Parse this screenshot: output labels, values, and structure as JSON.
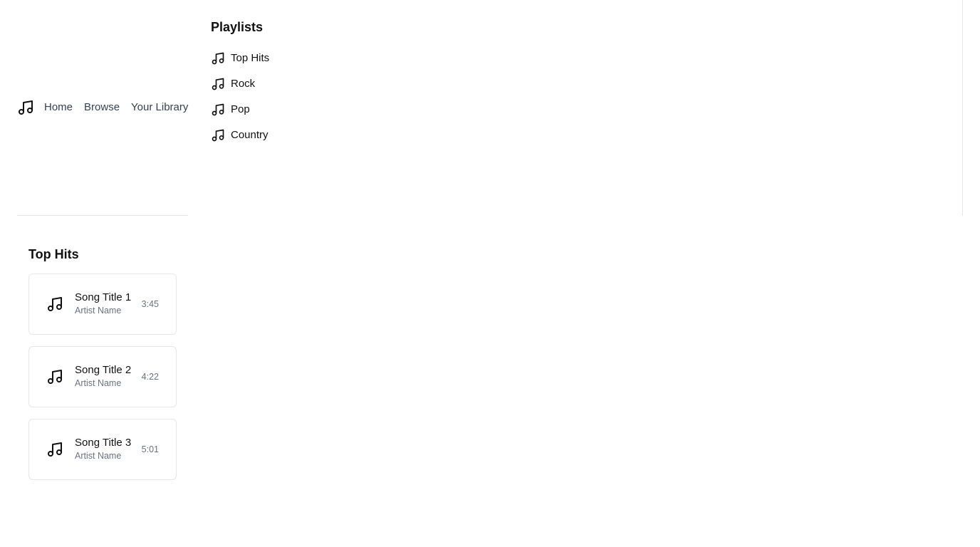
{
  "nav": {
    "logo_icon": "music-note-icon",
    "links": [
      "Home",
      "Browse",
      "Your Library"
    ]
  },
  "playlists": {
    "heading": "Playlists",
    "item_icon": "music-note-icon",
    "items": [
      "Top Hits",
      "Rock",
      "Pop",
      "Country"
    ]
  },
  "top_hits": {
    "heading": "Top Hits",
    "songs": [
      {
        "title": "Song Title 1",
        "artist": "Artist Name",
        "duration": "3:45"
      },
      {
        "title": "Song Title 2",
        "artist": "Artist Name",
        "duration": "4:22"
      },
      {
        "title": "Song Title 3",
        "artist": "Artist Name",
        "duration": "5:01"
      }
    ]
  }
}
